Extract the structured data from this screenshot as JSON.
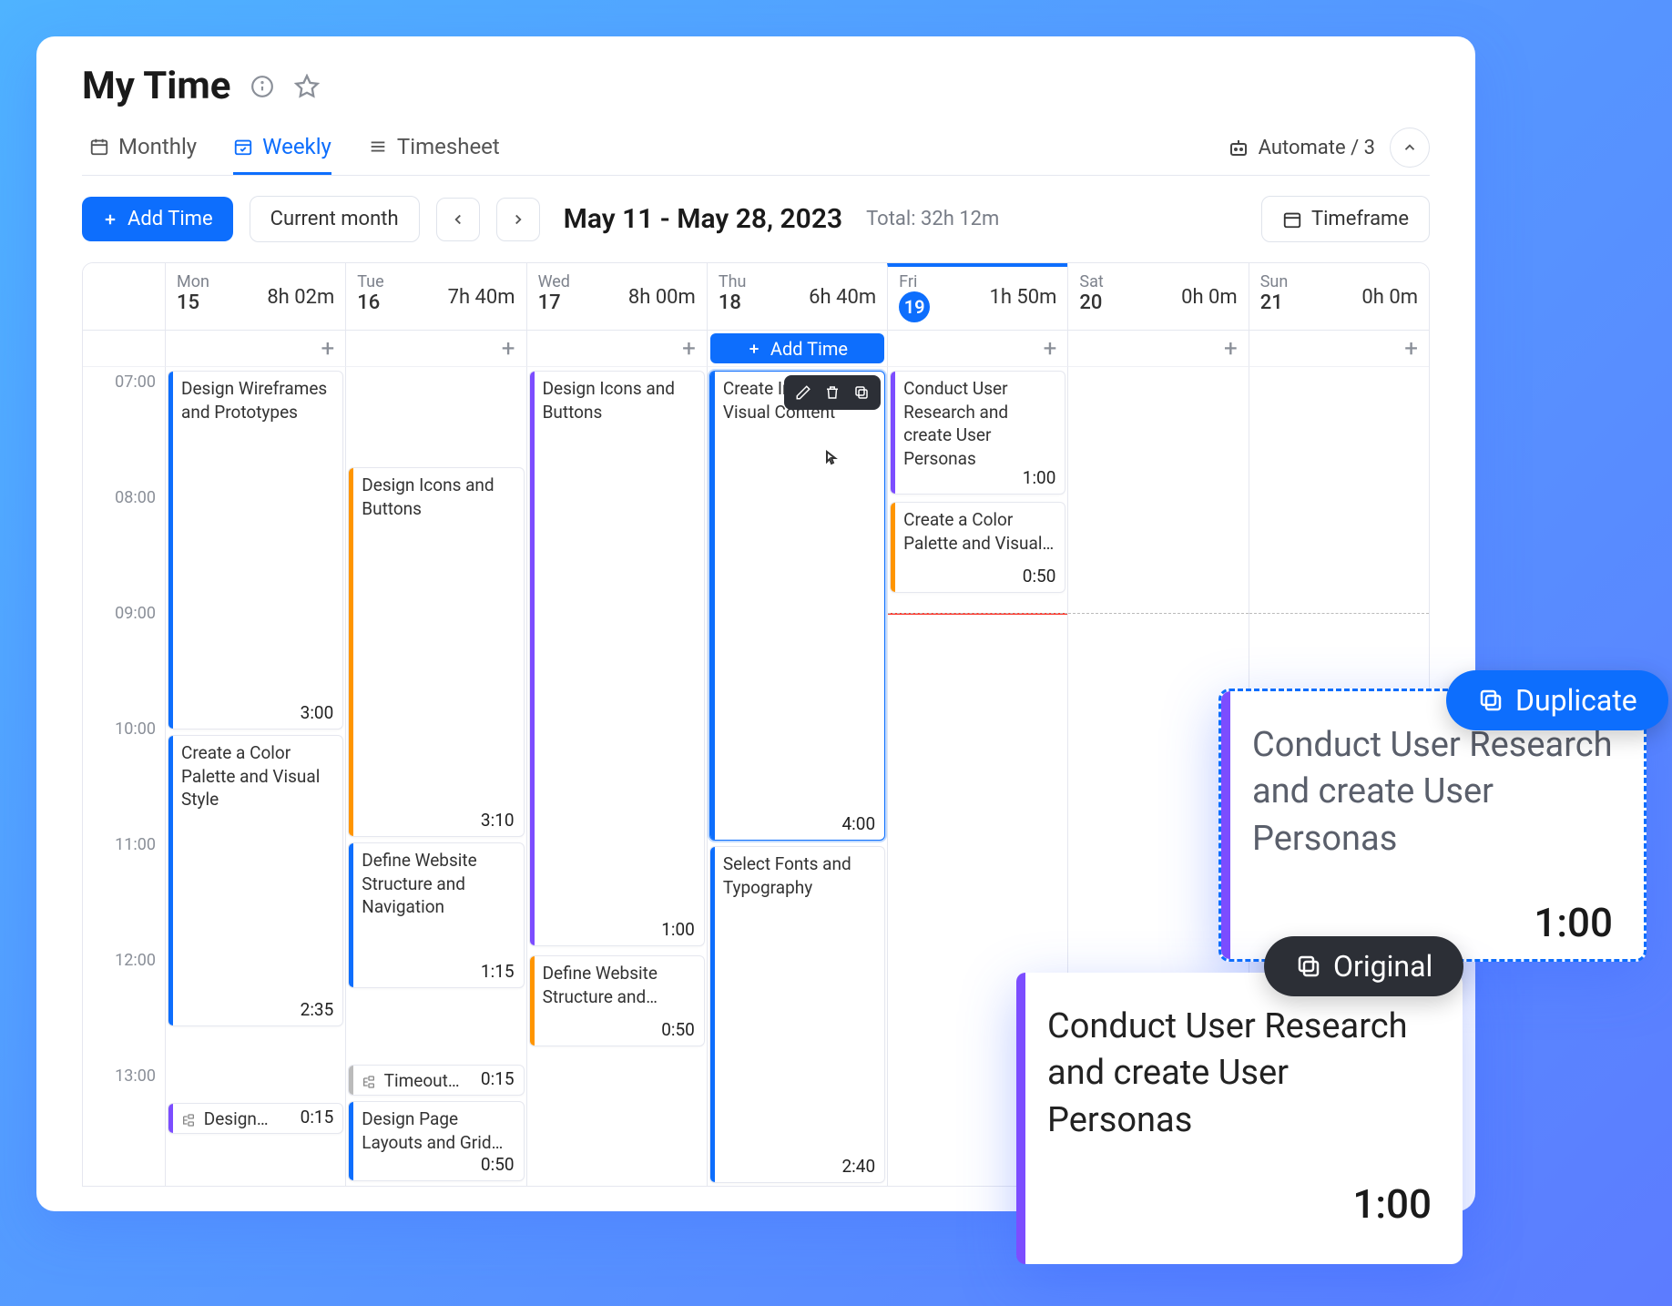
{
  "page_title": "My Time",
  "automate_label": "Automate / 3",
  "tabs": {
    "monthly": "Monthly",
    "weekly": "Weekly",
    "timesheet": "Timesheet"
  },
  "toolbar": {
    "add_time": "Add Time",
    "current_month": "Current month",
    "date_range": "May 11 - May 28, 2023",
    "total": "Total: 32h 12m",
    "timeframe": "Timeframe"
  },
  "days": [
    {
      "dow": "Mon",
      "num": "15",
      "total": "8h 02m"
    },
    {
      "dow": "Tue",
      "num": "16",
      "total": "7h 40m"
    },
    {
      "dow": "Wed",
      "num": "17",
      "total": "8h 00m"
    },
    {
      "dow": "Thu",
      "num": "18",
      "total": "6h 40m"
    },
    {
      "dow": "Fri",
      "num": "19",
      "total": "1h 50m",
      "today": true
    },
    {
      "dow": "Sat",
      "num": "20",
      "total": "0h 0m"
    },
    {
      "dow": "Sun",
      "num": "21",
      "total": "0h 0m"
    }
  ],
  "hours": [
    "07:00",
    "08:00",
    "09:00",
    "10:00",
    "11:00",
    "12:00",
    "13:00"
  ],
  "column_add_label": "Add Time",
  "events": {
    "mon": [
      {
        "title": "Design Wireframes and Prototypes",
        "dur": "3:00",
        "color": "#0d6efd"
      },
      {
        "title": "Create a Color Palette and Visual Style",
        "dur": "2:35",
        "color": "#0d6efd"
      },
      {
        "title": "Design…",
        "dur": "0:15",
        "color": "#7c4dff",
        "subtask": true
      }
    ],
    "tue": [
      {
        "title": "Design Icons and Buttons",
        "dur": "3:10",
        "color": "#ff9500"
      },
      {
        "title": "Define Website Structure and Navigation",
        "dur": "1:15",
        "color": "#0d6efd"
      },
      {
        "title": "Timeout…",
        "dur": "0:15",
        "color": "#888",
        "subtask": true
      },
      {
        "title": "Design Page Layouts and Grid…",
        "dur": "0:50",
        "color": "#0d6efd"
      }
    ],
    "wed": [
      {
        "title": "Design Icons and Buttons",
        "dur": "1:00",
        "color": "#7c4dff"
      },
      {
        "title": "Define Website Structure and…",
        "dur": "0:50",
        "color": "#ff9500"
      }
    ],
    "thu": [
      {
        "title": "Create Images and Visual Content",
        "dur": "4:00",
        "color": "#0d6efd",
        "selected": true
      },
      {
        "title": "Select Fonts and Typography",
        "dur": "2:40",
        "color": "#0d6efd"
      }
    ],
    "fri": [
      {
        "title": "Conduct User Research and create User Personas",
        "dur": "1:00",
        "color": "#7c4dff"
      },
      {
        "title": "Create a Color Palette and Visual…",
        "dur": "0:50",
        "color": "#ff9500"
      }
    ]
  },
  "overlay": {
    "duplicate_pill": "Duplicate",
    "original_pill": "Original",
    "card_title": "Conduct User Research and create User Personas",
    "card_dur": "1:00"
  }
}
